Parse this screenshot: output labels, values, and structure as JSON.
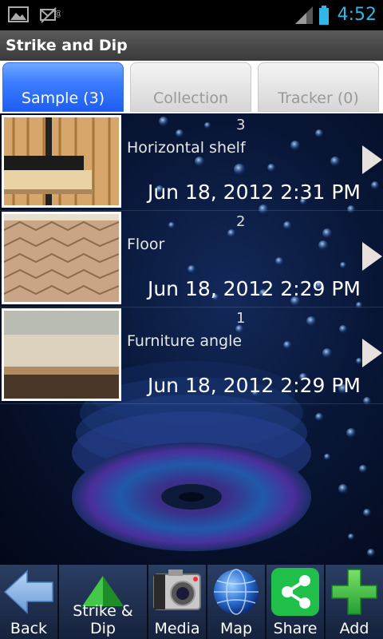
{
  "status_bar": {
    "time": "4:52"
  },
  "app": {
    "title": "Strike and Dip"
  },
  "tabs": [
    {
      "label": "Sample (3)",
      "active": true
    },
    {
      "label": "Collection",
      "active": false
    },
    {
      "label": "Tracker (0)",
      "active": false
    }
  ],
  "samples": [
    {
      "number": "3",
      "title": "Horizontal shelf",
      "date": "Jun 18, 2012 2:31 PM"
    },
    {
      "number": "2",
      "title": "Floor",
      "date": "Jun 18, 2012 2:29 PM"
    },
    {
      "number": "1",
      "title": "Furniture angle",
      "date": "Jun 18, 2012 2:29 PM"
    }
  ],
  "toolbar": {
    "back": "Back",
    "strike_dip": "Strike & Dip",
    "media": "Media",
    "map": "Map",
    "share": "Share",
    "add": "Add"
  },
  "colors": {
    "accent": "#33b5e5",
    "tab_active": "#3d7dff",
    "share_green": "#1fbf4a"
  }
}
